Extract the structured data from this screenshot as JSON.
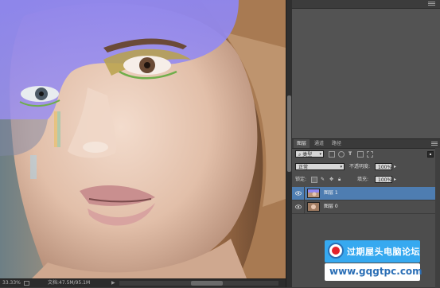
{
  "status_bar": {
    "zoom": "33.33%",
    "doc_info": "文档:47.5M/95.1M",
    "arrow": "▶"
  },
  "layers_panel": {
    "tabs": [
      "图层",
      "通道",
      "路径"
    ],
    "active_tab": 0,
    "filter_label": "类型",
    "blend_mode": "正常",
    "opacity_label": "不透明度:",
    "opacity_value": "100%",
    "lock_label": "锁定:",
    "fill_label": "填充:",
    "fill_value": "100%",
    "layers": [
      {
        "name": "图层 1",
        "selected": true
      },
      {
        "name": "图层 0",
        "selected": false
      }
    ]
  },
  "watermark": {
    "title": "过期屋头电脑论坛",
    "url": "www.gqgtpc.com"
  },
  "colors": {
    "selected_layer": "#4e7db1",
    "purple_overlay": "#8f86f0",
    "watermark_blue": "#36a9f0"
  }
}
